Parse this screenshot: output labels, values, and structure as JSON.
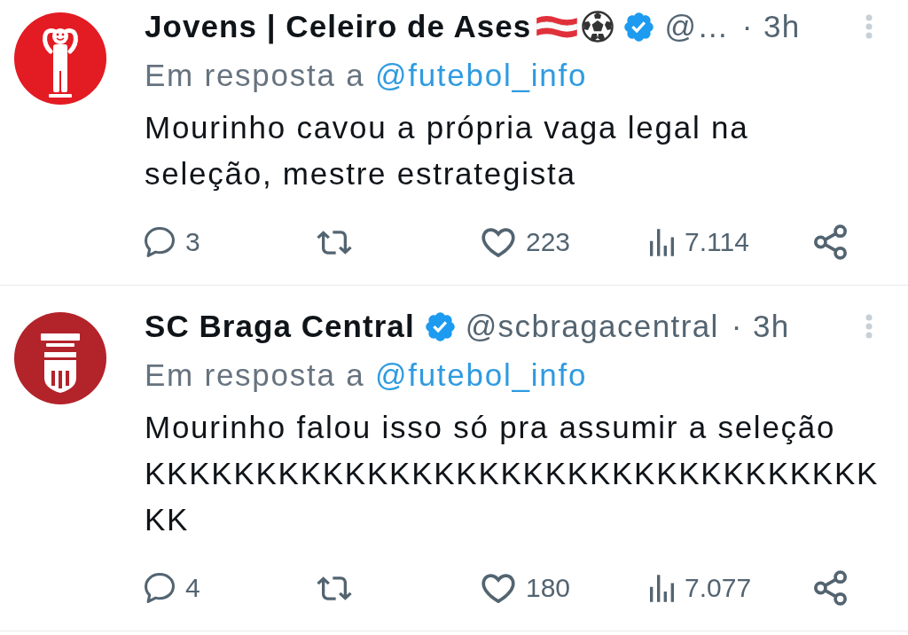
{
  "tweets": [
    {
      "avatar": {
        "kind": "figure"
      },
      "author": {
        "name": "Jovens | Celeiro de Ases",
        "emoji": [
          {
            "kind": "flag"
          },
          {
            "kind": "ball"
          }
        ],
        "verified": true,
        "handle": "@…",
        "time": "· 3h"
      },
      "reply_to": {
        "label": "Em resposta a",
        "handle": "@futebol_info"
      },
      "text": "Mourinho cavou a própria vaga legal na seleção, mestre estrategista",
      "actions": [
        {
          "kind": "reply",
          "count": "3"
        },
        {
          "kind": "repost"
        },
        {
          "kind": "like",
          "count": "223"
        },
        {
          "kind": "views",
          "count": "7.114"
        },
        {
          "kind": "share"
        }
      ]
    },
    {
      "avatar": {
        "kind": "crest"
      },
      "author": {
        "name": "SC Braga Central",
        "verified": true,
        "handle": "@scbragacentral",
        "time": "· 3h"
      },
      "reply_to": {
        "label": "Em resposta a",
        "handle": "@futebol_info"
      },
      "text": "Mourinho falou isso só pra assumir a seleção KKKKKKKKKKKKKKKKKKKKKKKKKKKKKKKKKKK",
      "actions": [
        {
          "kind": "reply",
          "count": "4"
        },
        {
          "kind": "repost"
        },
        {
          "kind": "like",
          "count": "180"
        },
        {
          "kind": "views",
          "count": "7.077"
        },
        {
          "kind": "share"
        }
      ]
    }
  ]
}
